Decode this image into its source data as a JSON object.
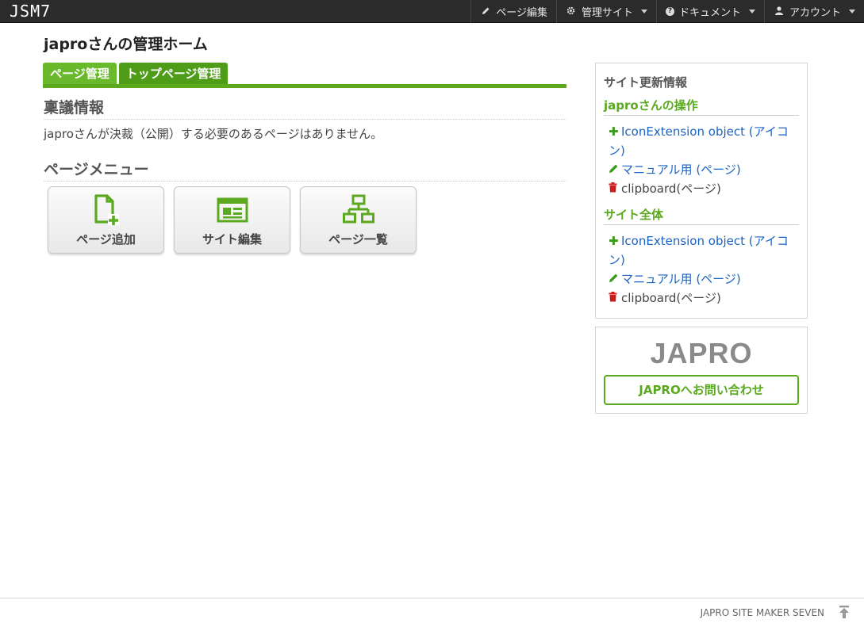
{
  "header": {
    "logo": "JSM7",
    "nav": [
      {
        "label": "ページ編集",
        "icon": "pencil-icon"
      },
      {
        "label": "管理サイト",
        "icon": "gear-icon"
      },
      {
        "label": "ドキュメント",
        "icon": "question-circle-icon"
      },
      {
        "label": "アカウント",
        "icon": "user-icon"
      }
    ]
  },
  "main": {
    "title": "japroさんの管理ホーム",
    "tabs": [
      {
        "label": "ページ管理"
      },
      {
        "label": "トップページ管理"
      }
    ],
    "approval": {
      "heading": "稟議情報",
      "text": "japroさんが決裁（公開）する必要のあるページはありません。"
    },
    "menu": {
      "heading": "ページメニュー",
      "buttons": [
        {
          "label": "ページ追加",
          "icon": "file-plus-icon"
        },
        {
          "label": "サイト編集",
          "icon": "browser-window-icon"
        },
        {
          "label": "ページ一覧",
          "icon": "sitemap-icon"
        }
      ]
    }
  },
  "sidebar": {
    "title": "サイト更新情報",
    "groups": [
      {
        "title": "japroさんの操作",
        "items": [
          {
            "type": "add",
            "text": "IconExtension object (アイコン)"
          },
          {
            "type": "edit",
            "text": "マニュアル用 (ページ)"
          },
          {
            "type": "delete",
            "text": "clipboard(ページ)"
          }
        ]
      },
      {
        "title": "サイト全体",
        "items": [
          {
            "type": "add",
            "text": "IconExtension object (アイコン)"
          },
          {
            "type": "edit",
            "text": "マニュアル用 (ページ)"
          },
          {
            "type": "delete",
            "text": "clipboard(ページ)"
          }
        ]
      }
    ],
    "logo": "JAPRO",
    "contact_button": "JAPROへお問い合わせ"
  },
  "footer": {
    "text": "JAPRO SITE MAKER SEVEN"
  },
  "colors": {
    "accent": "#5aa91f",
    "link": "#1a63c4",
    "topbar": "#2b2b2b",
    "delete": "#d11a1a"
  }
}
